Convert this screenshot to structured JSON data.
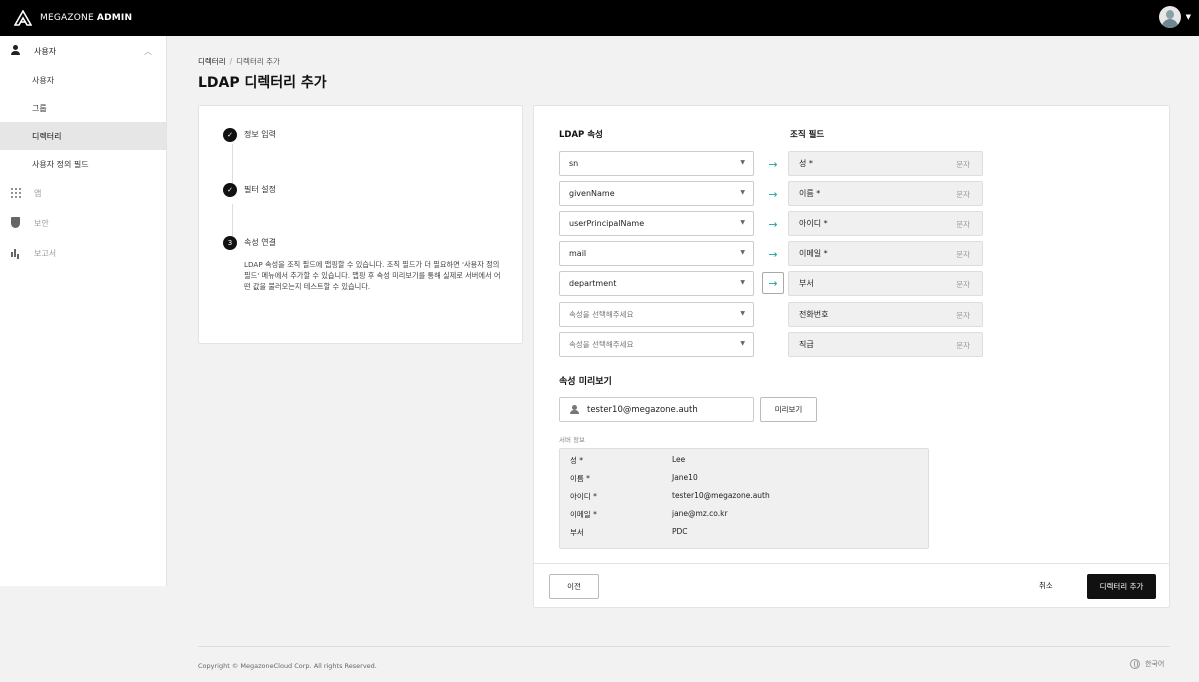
{
  "app": {
    "brand_prefix": "MEGAZONE",
    "brand_bold": "ADMIN"
  },
  "sidebar": {
    "groups": [
      {
        "label": "사용자",
        "items": [
          "사용자",
          "그룹",
          "디렉터리",
          "사용자 정의 필드"
        ]
      },
      {
        "label": "앱"
      },
      {
        "label": "보안"
      },
      {
        "label": "보고서"
      }
    ]
  },
  "breadcrumb": {
    "parent": "디렉터리",
    "current": "디렉터리 추가",
    "separator": "/"
  },
  "page_title": "LDAP 디렉터리 추가",
  "steps": [
    {
      "title": "정보 입력",
      "status": "done"
    },
    {
      "title": "필터 설정",
      "status": "done"
    },
    {
      "number": "3",
      "title": "속성 연결",
      "status": "current"
    }
  ],
  "step_description": "LDAP 속성을 조직 필드에 맵핑할 수 있습니다. 조직 필드가 더 필요하면 '사용자 정의 필드' 메뉴에서 추가할 수 있습니다. 맵핑 후 속성 미리보기를 통해 실제로 서버에서 어떤 값을 불러오는지 테스트할 수 있습니다.",
  "mapping": {
    "ldap_header": "LDAP 속성",
    "org_header": "조직 필드",
    "rows": [
      {
        "ldap": "sn",
        "field": "성 *",
        "type": "문자"
      },
      {
        "ldap": "givenName",
        "field": "이름 *",
        "type": "문자"
      },
      {
        "ldap": "userPrincipalName",
        "field": "아이디 *",
        "type": "문자"
      },
      {
        "ldap": "mail",
        "field": "이메일 *",
        "type": "문자"
      },
      {
        "ldap": "department",
        "field": "부서",
        "type": "문자"
      },
      {
        "ldap": "속성을 선택해주세요",
        "field": "전화번호",
        "type": "문자"
      },
      {
        "ldap": "속성을 선택해주세요",
        "field": "직급",
        "type": "문자"
      }
    ]
  },
  "preview": {
    "title": "속성 미리보기",
    "input_value": "tester10@megazone.auth",
    "button": "미리보기",
    "server_label": "서버 정보",
    "results": [
      {
        "key": "성 *",
        "value": "Lee"
      },
      {
        "key": "이름 *",
        "value": "Jane10"
      },
      {
        "key": "아이디 *",
        "value": "tester10@megazone.auth"
      },
      {
        "key": "이메일 *",
        "value": "jane@mz.co.kr"
      },
      {
        "key": "부서",
        "value": "PDC"
      }
    ]
  },
  "actions": {
    "prev": "이전",
    "cancel": "취소",
    "submit": "디렉터리 추가"
  },
  "footer": {
    "copyright": "Copyright © MegazoneCloud Corp. All rights Reserved.",
    "language": "한국어"
  }
}
